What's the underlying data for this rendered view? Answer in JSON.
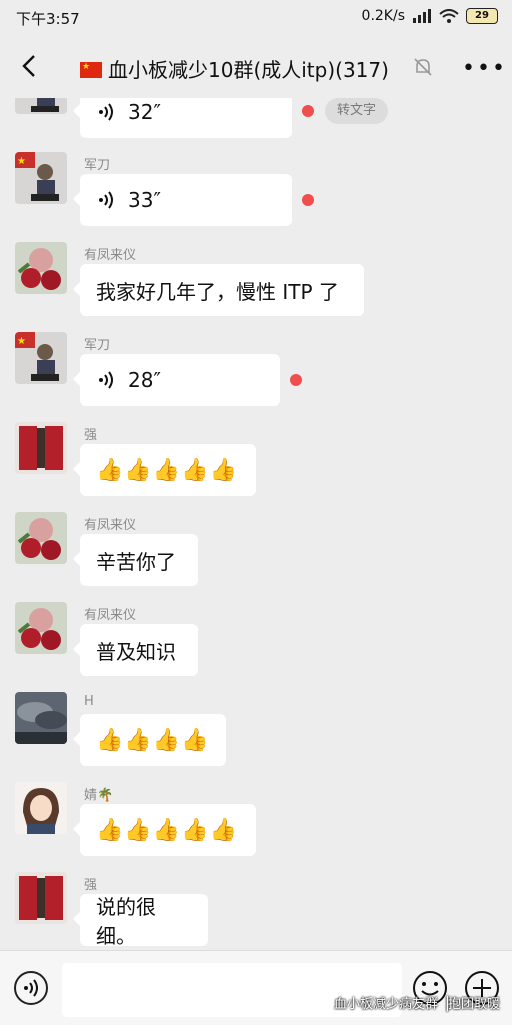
{
  "status": {
    "time": "下午3:57",
    "speed": "0.2K/s",
    "battery": "29"
  },
  "header": {
    "title": "血小板减少10群(成人itp)(317)"
  },
  "transcribe_label": "转文字",
  "messages": [
    {
      "sender": "",
      "type": "voice",
      "duration": "32″",
      "avatar": "soldier-avatar"
    },
    {
      "sender": "军刀",
      "type": "voice",
      "duration": "33″",
      "avatar": "soldier-avatar"
    },
    {
      "sender": "有凤来仪",
      "type": "text",
      "text": "我家好几年了，慢性 ITP 了",
      "avatar": "rose-avatar"
    },
    {
      "sender": "军刀",
      "type": "voice",
      "duration": "28″",
      "avatar": "soldier-avatar"
    },
    {
      "sender": "强",
      "type": "text",
      "text": "👍👍👍👍👍",
      "avatar": "red-door-avatar"
    },
    {
      "sender": "有凤来仪",
      "type": "text",
      "text": "辛苦你了",
      "avatar": "rose-avatar"
    },
    {
      "sender": "有凤来仪",
      "type": "text",
      "text": "普及知识",
      "avatar": "rose-avatar"
    },
    {
      "sender": "H",
      "type": "text",
      "text": "👍👍👍👍",
      "avatar": "cloud-avatar"
    },
    {
      "sender": "婧🌴",
      "type": "text",
      "text": "👍👍👍👍👍",
      "avatar": "girl-avatar"
    },
    {
      "sender": "强",
      "type": "text",
      "text": "说的很细。",
      "avatar": "red-door-avatar"
    }
  ],
  "watermark": "血小板减少病友群▕抱团取暖",
  "colors": {
    "background": "#ededed",
    "unread_dot": "#f04d4d",
    "bubble": "#ffffff"
  }
}
